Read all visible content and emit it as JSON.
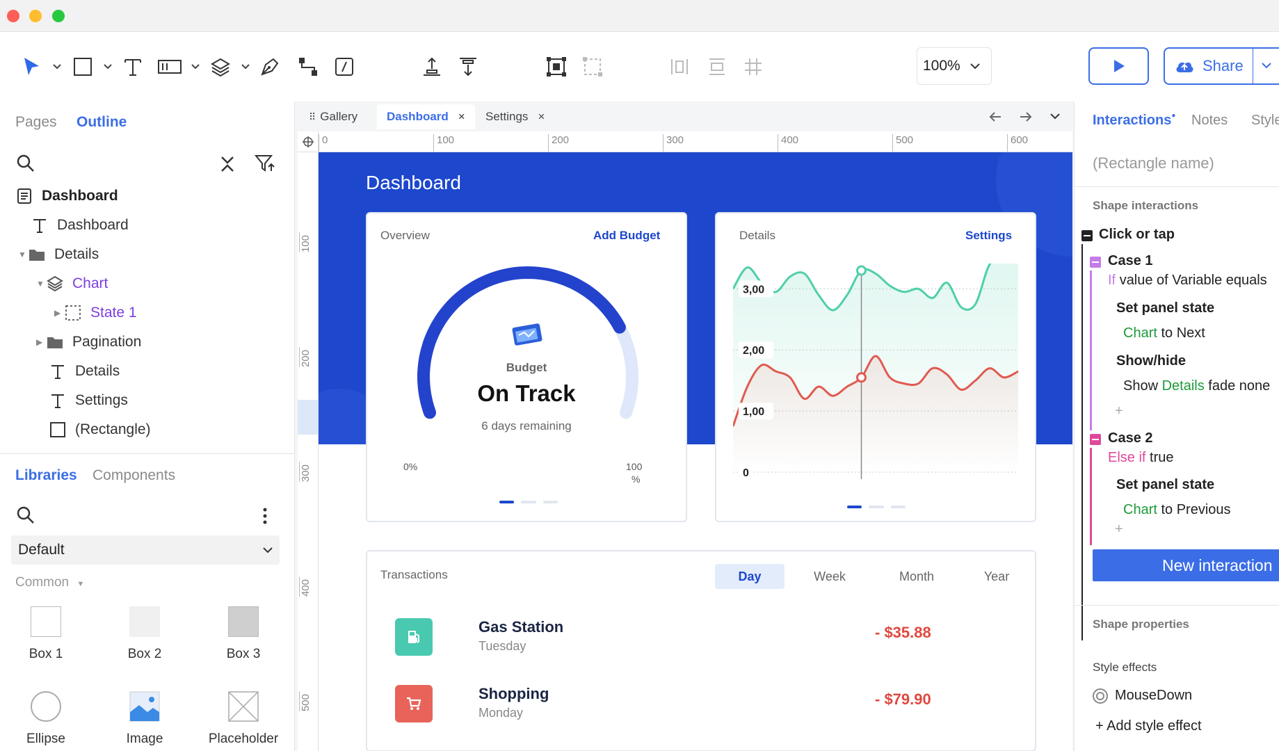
{
  "toolbar": {
    "zoom": "100%",
    "share_label": "Share"
  },
  "left_panel": {
    "tabs": [
      {
        "label": "Pages"
      },
      {
        "label": "Outline"
      }
    ],
    "outline": [
      {
        "label": "Dashboard"
      },
      {
        "label": "Dashboard"
      },
      {
        "label": "Details"
      },
      {
        "label": "Chart"
      },
      {
        "label": "State 1"
      },
      {
        "label": "Pagination"
      },
      {
        "label": "Details"
      },
      {
        "label": "Settings"
      },
      {
        "label": "(Rectangle)"
      }
    ],
    "lib_tabs": [
      {
        "label": "Libraries"
      },
      {
        "label": "Components"
      }
    ],
    "library_select": "Default",
    "category": "Common",
    "widgets": [
      {
        "label": "Box 1"
      },
      {
        "label": "Box 2"
      },
      {
        "label": "Box 3"
      },
      {
        "label": "Ellipse"
      },
      {
        "label": "Image"
      },
      {
        "label": "Placeholder"
      }
    ]
  },
  "canvas": {
    "tabs": [
      {
        "label": "Gallery"
      },
      {
        "label": "Dashboard"
      },
      {
        "label": "Settings"
      }
    ],
    "h_ticks": [
      "0",
      "100",
      "200",
      "300",
      "400",
      "500",
      "600"
    ],
    "v_ticks": [
      "100",
      "200",
      "300",
      "400",
      "500"
    ]
  },
  "dashboard": {
    "title": "Dashboard",
    "overview": {
      "label": "Overview",
      "link": "Add Budget",
      "budget_label": "Budget",
      "status": "On Track",
      "remaining": "6 days remaining",
      "min_label": "0%",
      "max_label": "100",
      "max_unit": "%",
      "gauge_fraction": 0.78
    },
    "details": {
      "label": "Details",
      "link": "Settings"
    },
    "transactions": {
      "label": "Transactions",
      "periods": [
        {
          "label": "Day"
        },
        {
          "label": "Week"
        },
        {
          "label": "Month"
        },
        {
          "label": "Year"
        }
      ],
      "rows": [
        {
          "name": "Gas Station",
          "day": "Tuesday",
          "amount": "- $35.88",
          "color": "#48c9b0"
        },
        {
          "name": "Shopping",
          "day": "Monday",
          "amount": "- $79.90",
          "color": "#e8635a"
        }
      ]
    }
  },
  "chart_data": {
    "type": "line",
    "yticks": [
      "3,00",
      "2,00",
      "1,00",
      "0"
    ],
    "ylim": [
      0,
      3.3
    ],
    "x": [
      0,
      0.5,
      1,
      1.5,
      2,
      2.5,
      3,
      3.5,
      4,
      4.5,
      5,
      5.5,
      6,
      6.5,
      7,
      7.5,
      8,
      8.5,
      9,
      9.5,
      10
    ],
    "series": [
      {
        "color": "#4fcfaa",
        "values": [
          3.0,
          3.35,
          3.1,
          2.95,
          3.2,
          3.25,
          2.9,
          2.65,
          2.9,
          3.3,
          3.25,
          3.05,
          2.95,
          3.0,
          2.85,
          3.1,
          2.7,
          2.75,
          3.4,
          3.45,
          3.6
        ]
      },
      {
        "color": "#e05a50",
        "values": [
          0.75,
          1.4,
          1.75,
          1.65,
          1.55,
          1.2,
          1.4,
          1.25,
          1.4,
          1.55,
          1.9,
          1.55,
          1.45,
          1.45,
          1.7,
          1.6,
          1.35,
          1.5,
          1.7,
          1.55,
          1.65
        ]
      }
    ],
    "highlight_x": 4.5
  },
  "right_panel": {
    "tabs": [
      {
        "label": "Interactions"
      },
      {
        "label": "Notes"
      },
      {
        "label": "Style"
      }
    ],
    "name_placeholder": "(Rectangle name)",
    "shape_interactions": "Shape interactions",
    "event": "Click or tap",
    "case1": {
      "title": "Case 1",
      "cond_kw": "If",
      "cond": "value of Variable equals"
    },
    "action1": "Set panel state",
    "action1_target": "Chart",
    "action1_rest": "to Next",
    "action2": "Show/hide",
    "action2_pre": "Show",
    "action2_target": "Details",
    "action2_rest": "fade none",
    "case2": {
      "title": "Case 2",
      "cond_kw": "Else if",
      "cond": "true"
    },
    "action3": "Set panel state",
    "action3_target": "Chart",
    "action3_rest": "to Previous",
    "new_interaction": "New interaction",
    "shape_properties": "Shape properties",
    "style_effects": "Style effects",
    "mousedown": "MouseDown",
    "add_style": "+ Add style effect"
  }
}
